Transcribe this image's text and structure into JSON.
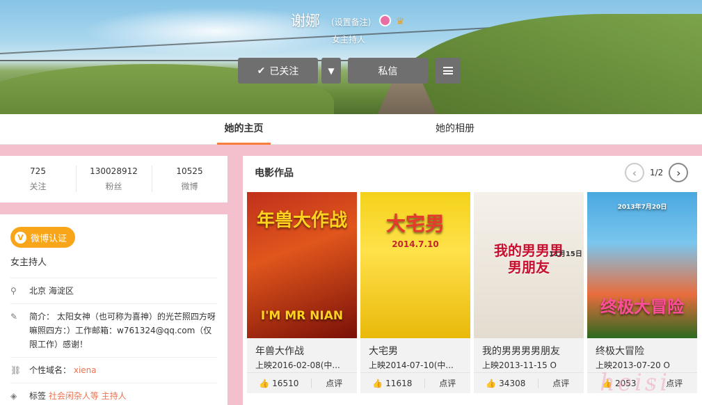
{
  "profile": {
    "name": "谢娜",
    "remark_link": "(设置备注)",
    "title": "女主持人"
  },
  "actions": {
    "follow_label": "已关注",
    "message_label": "私信"
  },
  "tabs": [
    {
      "label": "她的主页",
      "active": true
    },
    {
      "label": "她的相册",
      "active": false
    }
  ],
  "stats": [
    {
      "value": "725",
      "label": "关注"
    },
    {
      "value": "130028912",
      "label": "粉丝"
    },
    {
      "value": "10525",
      "label": "微博"
    }
  ],
  "info": {
    "verify_label": "微博认证",
    "role": "女主持人",
    "location": "北京 海淀区",
    "bio": "简介： 太阳女神（也可称为喜神）的光芒照四方呀嘛照四方：）工作邮箱：w761324@qq.com（仅限工作）感谢！",
    "domain_label": "个性域名：",
    "domain_value": "xiena",
    "tags_label": "标签",
    "tags_value": "社会闲杂人等 主持人"
  },
  "movies": {
    "section_title": "电影作品",
    "page": "1/2",
    "items": [
      {
        "name": "年兽大作战",
        "date": "上映2016-02-08(中...",
        "likes": "16510",
        "rate": "点评",
        "poster_text": "年兽大作战",
        "poster_sub": "I'M MR NIAN"
      },
      {
        "name": "大宅男",
        "date": "上映2014-07-10(中...",
        "likes": "11618",
        "rate": "点评",
        "poster_text": "大宅男",
        "poster_sub": "2014.7.10"
      },
      {
        "name": "我的男男男男朋友",
        "date": "上映2013-11-15 O",
        "likes": "34308",
        "rate": "点评",
        "poster_text": "我的男男男男朋友",
        "poster_sub": "11月15日"
      },
      {
        "name": "终极大冒险",
        "date": "上映2013-07-20 O",
        "likes": "2053",
        "rate": "点评",
        "poster_text": "终极大冒险",
        "poster_sub": "2013年7月20日"
      }
    ]
  },
  "watermark": "heisi",
  "colors": {
    "accent": "#fa7d3c",
    "verify": "#f8a519",
    "link": "#eb7350",
    "page_bg": "#f5c0cd"
  }
}
